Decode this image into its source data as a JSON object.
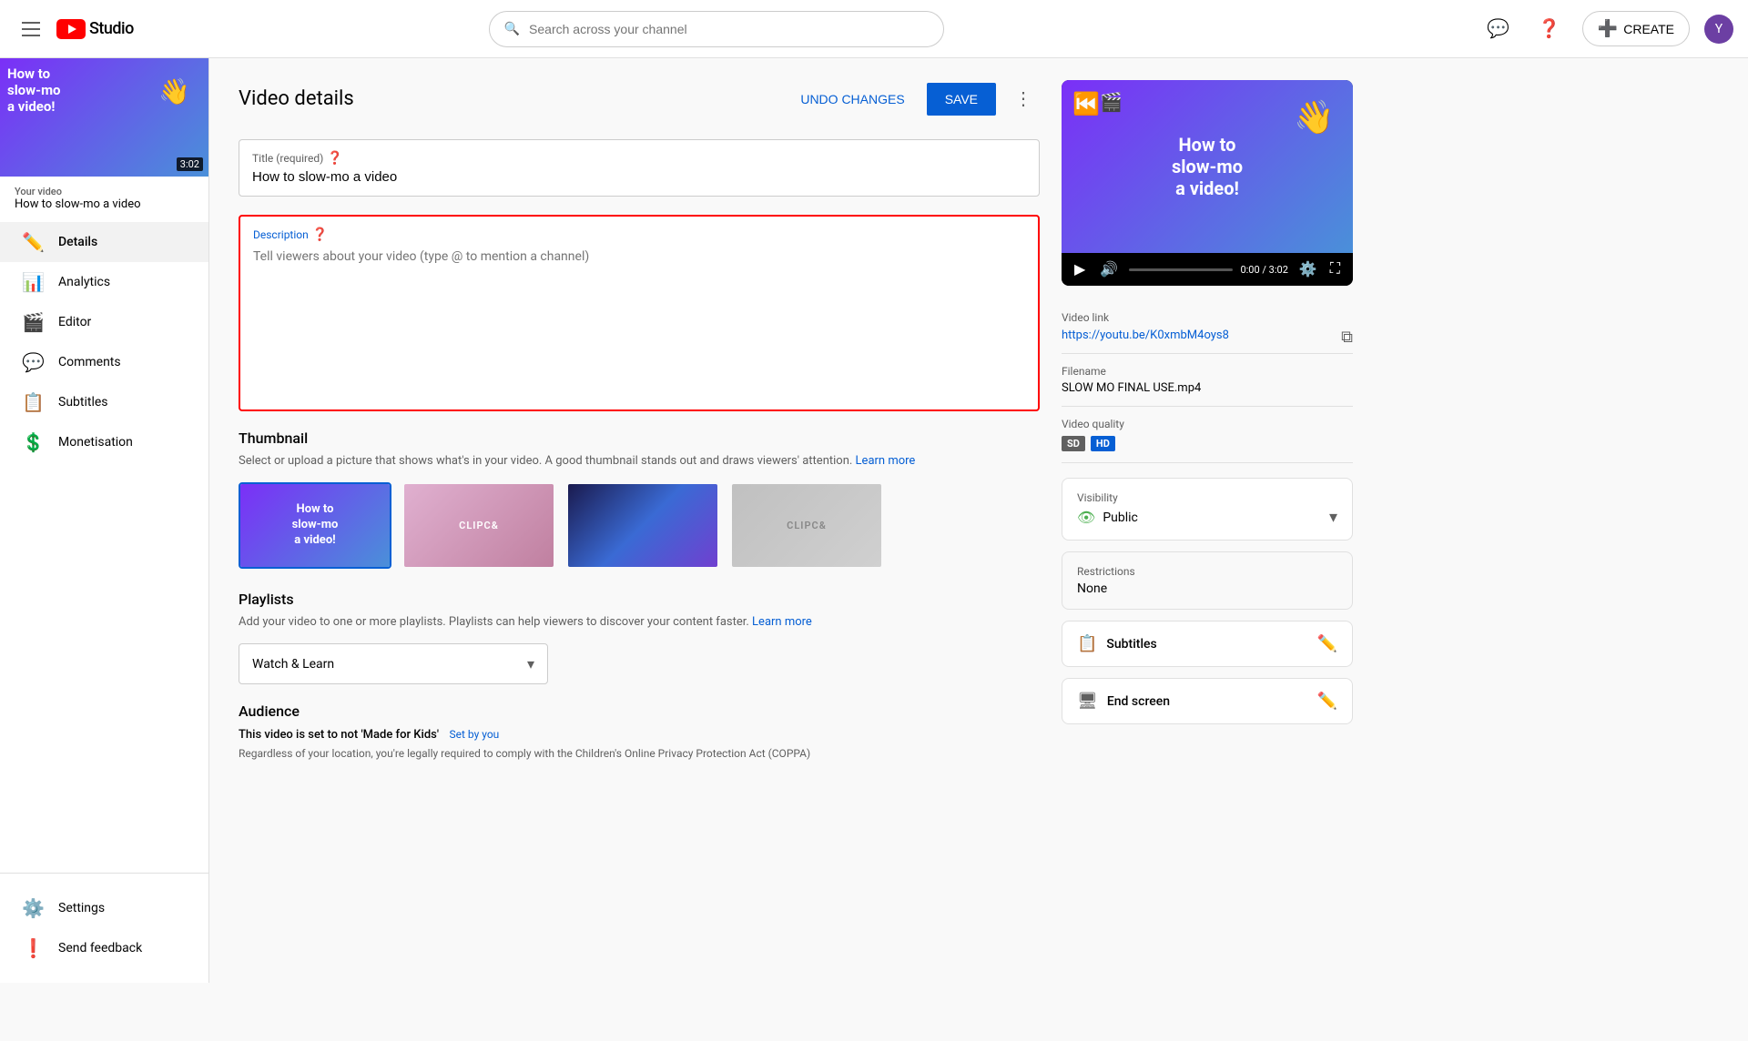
{
  "topbar": {
    "hamburger_label": "Menu",
    "logo_text": "Studio",
    "search_placeholder": "Search across your channel",
    "create_label": "CREATE",
    "avatar_initials": "Y"
  },
  "sidebar": {
    "video_thumb": {
      "title": "How to slow-mo a video!",
      "duration": "3:02"
    },
    "your_video_label": "Your video",
    "video_title": "How to slow-mo a video",
    "nav_items": [
      {
        "id": "details",
        "label": "Details",
        "icon": "✏️",
        "active": true
      },
      {
        "id": "analytics",
        "label": "Analytics",
        "icon": "📊",
        "active": false
      },
      {
        "id": "editor",
        "label": "Editor",
        "icon": "🎬",
        "active": false
      },
      {
        "id": "comments",
        "label": "Comments",
        "icon": "💬",
        "active": false
      },
      {
        "id": "subtitles",
        "label": "Subtitles",
        "icon": "📋",
        "active": false
      },
      {
        "id": "monetisation",
        "label": "Monetisation",
        "icon": "💲",
        "active": false
      }
    ],
    "bottom_items": [
      {
        "id": "settings",
        "label": "Settings",
        "icon": "⚙️"
      },
      {
        "id": "feedback",
        "label": "Send feedback",
        "icon": "❗"
      }
    ]
  },
  "main": {
    "page_title": "Video details",
    "undo_label": "UNDO CHANGES",
    "save_label": "SAVE",
    "title_field": {
      "label": "Title (required)",
      "value": "How to slow-mo a video"
    },
    "description_field": {
      "label": "Description",
      "placeholder": "Tell viewers about your video (type @ to mention a channel)"
    },
    "thumbnail_section": {
      "title": "Thumbnail",
      "desc": "Select or upload a picture that shows what's in your video. A good thumbnail stands out and draws viewers' attention.",
      "learn_more": "Learn more"
    },
    "playlist_section": {
      "title": "Playlists",
      "desc": "Add your video to one or more playlists. Playlists can help viewers to discover your content faster.",
      "learn_more": "Learn more",
      "selected": "Watch & Learn"
    },
    "audience_section": {
      "title": "Audience",
      "made_for_kids_label": "This video is set to not 'Made for Kids'",
      "set_by": "Set by you",
      "desc": "Regardless of your location, you're legally required to comply with the Children's Online Privacy Protection Act (COPPA)"
    }
  },
  "right_panel": {
    "video_link_label": "Video link",
    "video_link": "https://youtu.be/K0xmbM4oys8",
    "filename_label": "Filename",
    "filename": "SLOW MO FINAL USE.mp4",
    "quality_label": "Video quality",
    "quality_badges": [
      "SD",
      "HD"
    ],
    "video_time": "0:00 / 3:02",
    "visibility_label": "Visibility",
    "visibility_value": "Public",
    "restrictions_label": "Restrictions",
    "restrictions_value": "None",
    "subtitles_label": "Subtitles",
    "end_screen_label": "End screen"
  }
}
